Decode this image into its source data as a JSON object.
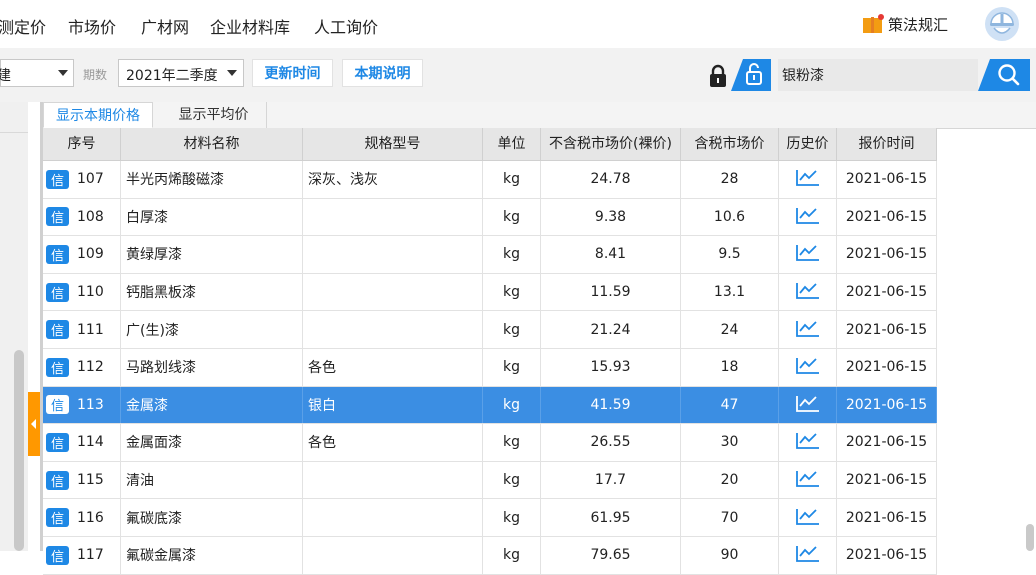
{
  "topnav": {
    "items": [
      "测定价",
      "市场价",
      "广材网",
      "企业材料库",
      "人工询价"
    ],
    "policy_label": "策法规汇"
  },
  "toolbar": {
    "left_select_value": "建",
    "period_label": "期数",
    "period_value": "2021年二季度",
    "update_time_label": "更新时间",
    "period_note_label": "本期说明",
    "search_value": "银粉漆"
  },
  "tabs": {
    "current": "显示本期价格",
    "average": "显示平均价"
  },
  "table": {
    "headers": [
      "序号",
      "材料名称",
      "规格型号",
      "单位",
      "不含税市场价(裸价)",
      "含税市场价",
      "历史价",
      "报价时间"
    ],
    "badge_text": "信",
    "rows": [
      {
        "no": "107",
        "name": "半光丙烯酸磁漆",
        "spec": "深灰、浅灰",
        "unit": "kg",
        "price_ex": "24.78",
        "price_inc": "28",
        "date": "2021-06-15"
      },
      {
        "no": "108",
        "name": "白厚漆",
        "spec": "",
        "unit": "kg",
        "price_ex": "9.38",
        "price_inc": "10.6",
        "date": "2021-06-15"
      },
      {
        "no": "109",
        "name": "黄绿厚漆",
        "spec": "",
        "unit": "kg",
        "price_ex": "8.41",
        "price_inc": "9.5",
        "date": "2021-06-15"
      },
      {
        "no": "110",
        "name": "钙脂黑板漆",
        "spec": "",
        "unit": "kg",
        "price_ex": "11.59",
        "price_inc": "13.1",
        "date": "2021-06-15"
      },
      {
        "no": "111",
        "name": "广(生)漆",
        "spec": "",
        "unit": "kg",
        "price_ex": "21.24",
        "price_inc": "24",
        "date": "2021-06-15"
      },
      {
        "no": "112",
        "name": "马路划线漆",
        "spec": "各色",
        "unit": "kg",
        "price_ex": "15.93",
        "price_inc": "18",
        "date": "2021-06-15"
      },
      {
        "no": "113",
        "name": "金属漆",
        "spec": "银白",
        "unit": "kg",
        "price_ex": "41.59",
        "price_inc": "47",
        "date": "2021-06-15",
        "selected": true
      },
      {
        "no": "114",
        "name": "金属面漆",
        "spec": "各色",
        "unit": "kg",
        "price_ex": "26.55",
        "price_inc": "30",
        "date": "2021-06-15"
      },
      {
        "no": "115",
        "name": "清油",
        "spec": "",
        "unit": "kg",
        "price_ex": "17.7",
        "price_inc": "20",
        "date": "2021-06-15"
      },
      {
        "no": "116",
        "name": "氟碳底漆",
        "spec": "",
        "unit": "kg",
        "price_ex": "61.95",
        "price_inc": "70",
        "date": "2021-06-15"
      },
      {
        "no": "117",
        "name": "氟碳金属漆",
        "spec": "",
        "unit": "kg",
        "price_ex": "79.65",
        "price_inc": "90",
        "date": "2021-06-15"
      }
    ]
  },
  "colors": {
    "accent": "#1e88e5",
    "selected_row": "#3b8ee3",
    "handle": "#ff9800"
  }
}
